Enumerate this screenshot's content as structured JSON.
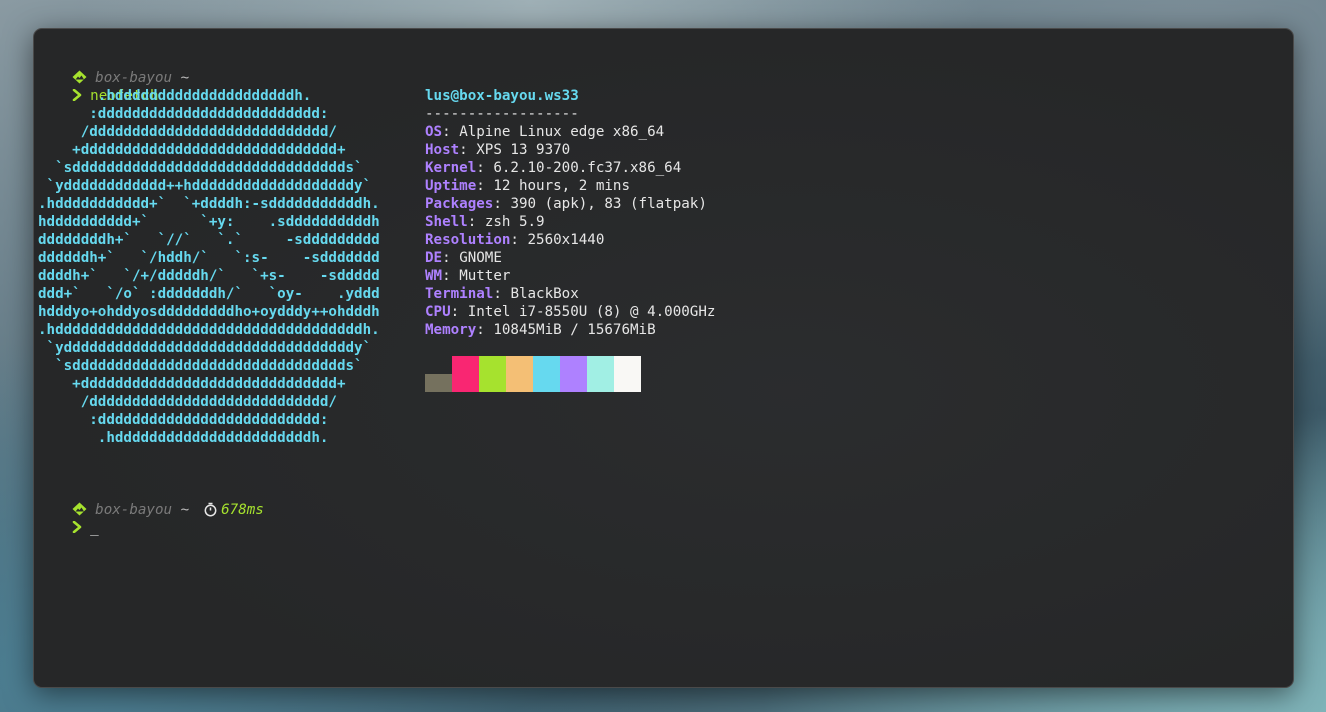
{
  "prompt1": {
    "host": "box-bayou",
    "tilde": "~",
    "command": "neofetch"
  },
  "prompt2": {
    "host": "box-bayou",
    "tilde": "~",
    "duration": "678ms",
    "cursor": "_"
  },
  "ascii_logo": [
    "       .hdddddddddddddddddddddh.",
    "      :dddddddddddddddddddddddddd:",
    "     /dddddddddddddddddddddddddddd/",
    "    +dddddddddddddddddddddddddddddd+",
    "  `sdddddddddddddddddddddddddddddddds`",
    " `ydddddddddddd++hdddddddddddddddddddy`",
    ".hddddddddddd+`  `+ddddh:-sdddddddddddh.",
    "hdddddddddd+`      `+y:    .sddddddddddh",
    "ddddddddh+`   `//`   `.`     -sddddddddd",
    "ddddddh+`   `/hddh/`   `:s-    -sddddddd",
    "ddddh+`   `/+/dddddh/`   `+s-    -sddddd",
    "ddd+`   `/o` :dddddddh/`   `oy-    .yddd",
    "hdddyo+ohddyosdddddddddho+oydddy++ohdddh",
    ".hddddddddddddddddddddddddddddddddddddh.",
    " `yddddddddddddddddddddddddddddddddddy`",
    "  `sdddddddddddddddddddddddddddddddds`",
    "    +dddddddddddddddddddddddddddddd+",
    "     /dddddddddddddddddddddddddddd/",
    "      :dddddddddddddddddddddddddd:",
    "       .hdddddddddddddddddddddddh."
  ],
  "sysinfo": {
    "user_host": "lus@box-bayou.ws33",
    "separator": "------------------",
    "rows": [
      {
        "key": "OS",
        "value": "Alpine Linux edge x86_64"
      },
      {
        "key": "Host",
        "value": "XPS 13 9370"
      },
      {
        "key": "Kernel",
        "value": "6.2.10-200.fc37.x86_64"
      },
      {
        "key": "Uptime",
        "value": "12 hours, 2 mins"
      },
      {
        "key": "Packages",
        "value": "390 (apk), 83 (flatpak)"
      },
      {
        "key": "Shell",
        "value": "zsh 5.9"
      },
      {
        "key": "Resolution",
        "value": "2560x1440"
      },
      {
        "key": "DE",
        "value": "GNOME"
      },
      {
        "key": "WM",
        "value": "Mutter"
      },
      {
        "key": "Terminal",
        "value": "BlackBox"
      },
      {
        "key": "CPU",
        "value": "Intel i7-8550U (8) @ 4.000GHz"
      },
      {
        "key": "Memory",
        "value": "10845MiB / 15676MiB"
      }
    ]
  },
  "palette": [
    "#75715e",
    "#f92672",
    "#a6e22e",
    "#f4bf75",
    "#66d9ef",
    "#ae81ff",
    "#a1efe4",
    "#f9f8f5"
  ],
  "colors": {
    "accent_green": "#a6e22e",
    "accent_cyan": "#66d9ef",
    "accent_purple": "#ae81ff",
    "terminal_bg": "#262728",
    "foreground": "#e6e6e6"
  }
}
